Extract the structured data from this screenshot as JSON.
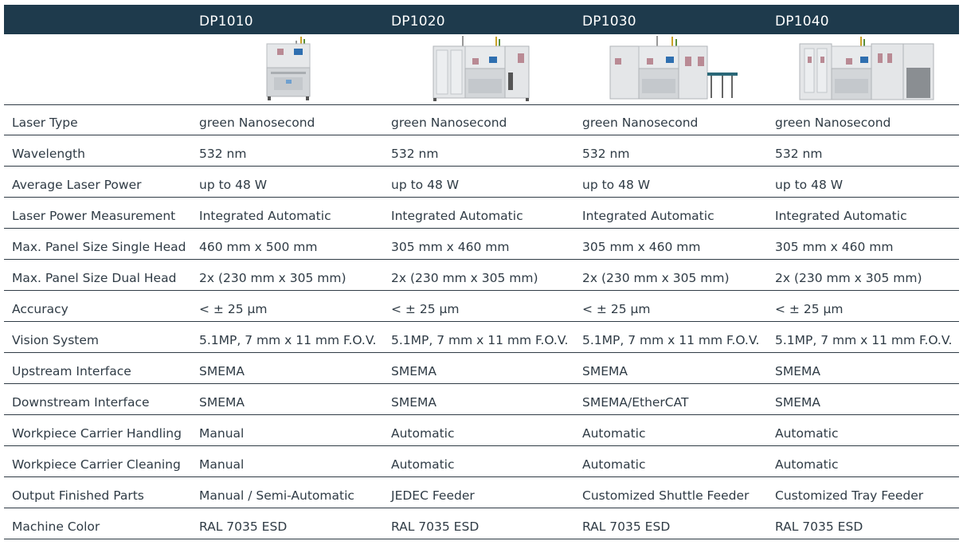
{
  "header": {
    "models": [
      "DP1010",
      "DP1020",
      "DP1030",
      "DP1040"
    ]
  },
  "images": [
    {
      "icon": "machine-dp1010-image"
    },
    {
      "icon": "machine-dp1020-image"
    },
    {
      "icon": "machine-dp1030-image"
    },
    {
      "icon": "machine-dp1040-image"
    }
  ],
  "rows": [
    {
      "label": "Laser Type",
      "values": [
        "green Nanosecond",
        "green Nanosecond",
        "green Nanosecond",
        "green Nanosecond"
      ]
    },
    {
      "label": "Wavelength",
      "values": [
        "532 nm",
        "532 nm",
        "532 nm",
        "532 nm"
      ]
    },
    {
      "label": "Average Laser Power",
      "values": [
        "up to 48 W",
        "up to 48 W",
        "up to 48 W",
        "up to 48 W"
      ]
    },
    {
      "label": "Laser Power Measurement",
      "values": [
        "Integrated Automatic",
        "Integrated Automatic",
        "Integrated Automatic",
        "Integrated Automatic"
      ]
    },
    {
      "label": "Max. Panel Size Single Head",
      "values": [
        "460 mm x 500 mm",
        "305 mm x 460 mm",
        "305 mm x 460 mm",
        "305 mm x 460 mm"
      ]
    },
    {
      "label": "Max. Panel Size Dual Head",
      "values": [
        "2x (230 mm x 305 mm)",
        "2x (230 mm x 305 mm)",
        "2x (230 mm x 305 mm)",
        "2x (230 mm x 305 mm)"
      ]
    },
    {
      "label": "Accuracy",
      "values": [
        "< ± 25 µm",
        "< ± 25 µm",
        "< ± 25 µm",
        "< ± 25 µm"
      ]
    },
    {
      "label": "Vision System",
      "values": [
        "5.1MP, 7 mm x 11 mm F.O.V.",
        "5.1MP, 7 mm x 11 mm F.O.V.",
        "5.1MP, 7 mm x 11 mm F.O.V.",
        "5.1MP, 7 mm x 11 mm F.O.V."
      ]
    },
    {
      "label": "Upstream Interface",
      "values": [
        "SMEMA",
        "SMEMA",
        "SMEMA",
        "SMEMA"
      ]
    },
    {
      "label": "Downstream Interface",
      "values": [
        "SMEMA",
        "SMEMA",
        "SMEMA/EtherCAT",
        "SMEMA"
      ]
    },
    {
      "label": "Workpiece Carrier Handling",
      "values": [
        "Manual",
        "Automatic",
        "Automatic",
        "Automatic"
      ]
    },
    {
      "label": "Workpiece Carrier Cleaning",
      "values": [
        "Manual",
        "Automatic",
        "Automatic",
        "Automatic"
      ]
    },
    {
      "label": "Output Finished Parts",
      "values": [
        "Manual / Semi-Automatic",
        "JEDEC Feeder",
        "Customized Shuttle Feeder",
        "Customized Tray Feeder"
      ]
    },
    {
      "label": "Machine Color",
      "values": [
        "RAL 7035 ESD",
        "RAL 7035 ESD",
        "RAL 7035 ESD",
        "RAL 7035 ESD"
      ]
    }
  ],
  "colors": {
    "header_bg": "#1e3a4c",
    "text": "#2f3b45",
    "machine_body": "#dcdfe2"
  }
}
